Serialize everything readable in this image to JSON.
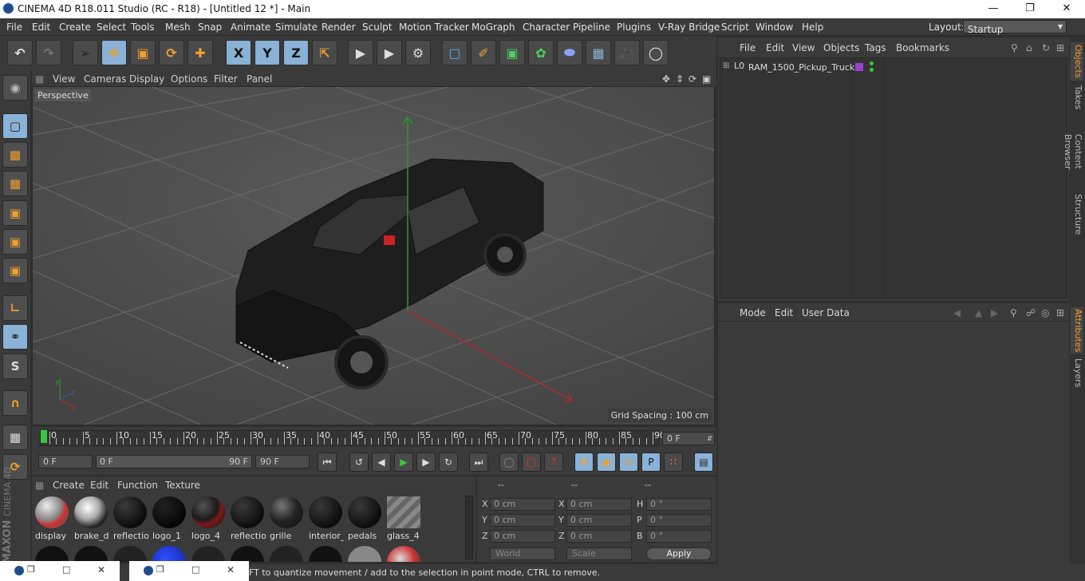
{
  "window": {
    "title": "CINEMA 4D R18.011 Studio (RC - R18) - [Untitled 12 *] - Main"
  },
  "menu": [
    "File",
    "Edit",
    "Create",
    "Select",
    "Tools",
    "Mesh",
    "Snap",
    "Animate",
    "Simulate",
    "Render",
    "Sculpt",
    "Motion Tracker",
    "MoGraph",
    "Character",
    "Pipeline",
    "Plugins",
    "V-Ray Bridge",
    "Script",
    "Window",
    "Help"
  ],
  "layout": {
    "label": "Layout:",
    "value": "Startup"
  },
  "toolbar": {
    "axis_x": "X",
    "axis_y": "Y",
    "axis_z": "Z"
  },
  "viewport": {
    "menu": [
      "View",
      "Cameras",
      "Display",
      "Options",
      "Filter",
      "Panel"
    ],
    "camera_label": "Perspective",
    "grid_spacing": "Grid Spacing : 100 cm"
  },
  "timeline": {
    "ticks": [
      "0",
      "5",
      "10",
      "15",
      "20",
      "25",
      "30",
      "35",
      "40",
      "45",
      "50",
      "55",
      "60",
      "65",
      "70",
      "75",
      "80",
      "85",
      "90"
    ],
    "current_frame": "0 F"
  },
  "anim": {
    "start": "0 F",
    "range_start": "0 F",
    "range_end": "90 F",
    "end": "90 F"
  },
  "materials": {
    "menu": [
      "Create",
      "Edit",
      "Function",
      "Texture"
    ],
    "row1": [
      "display",
      "brake_d",
      "reflectio",
      "logo_1",
      "logo_4",
      "reflectio",
      "grille",
      "interior_",
      "pedals",
      "glass_4"
    ]
  },
  "coords": {
    "headers": [
      "--",
      "--",
      "--"
    ],
    "rows": [
      {
        "l1": "X",
        "v1": "0 cm",
        "l2": "X",
        "v2": "0 cm",
        "l3": "H",
        "v3": "0 °"
      },
      {
        "l1": "Y",
        "v1": "0 cm",
        "l2": "Y",
        "v2": "0 cm",
        "l3": "P",
        "v3": "0 °"
      },
      {
        "l1": "Z",
        "v1": "0 cm",
        "l2": "Z",
        "v2": "0 cm",
        "l3": "B",
        "v3": "0 °"
      }
    ],
    "world": "World",
    "scale": "Scale",
    "apply": "Apply"
  },
  "objects": {
    "menu": [
      "File",
      "Edit",
      "View",
      "Objects",
      "Tags",
      "Bookmarks"
    ],
    "items": [
      {
        "name": "RAM_1500_Pickup_Truck"
      }
    ]
  },
  "attributes": {
    "menu": [
      "Mode",
      "Edit",
      "User Data"
    ]
  },
  "right_tabs": [
    "Objects",
    "Takes",
    "Content Browser",
    "Structure",
    "Attributes",
    "Layers"
  ],
  "status": {
    "text": "FT to quantize movement / add to the selection in point mode, CTRL to remove."
  },
  "brand": {
    "maxon": "MAXON",
    "product": "CINEMA 4D"
  },
  "colors": {
    "accent": "#f0a030",
    "selected": "#8ab1d6",
    "viewport": "#4e4e4e"
  }
}
